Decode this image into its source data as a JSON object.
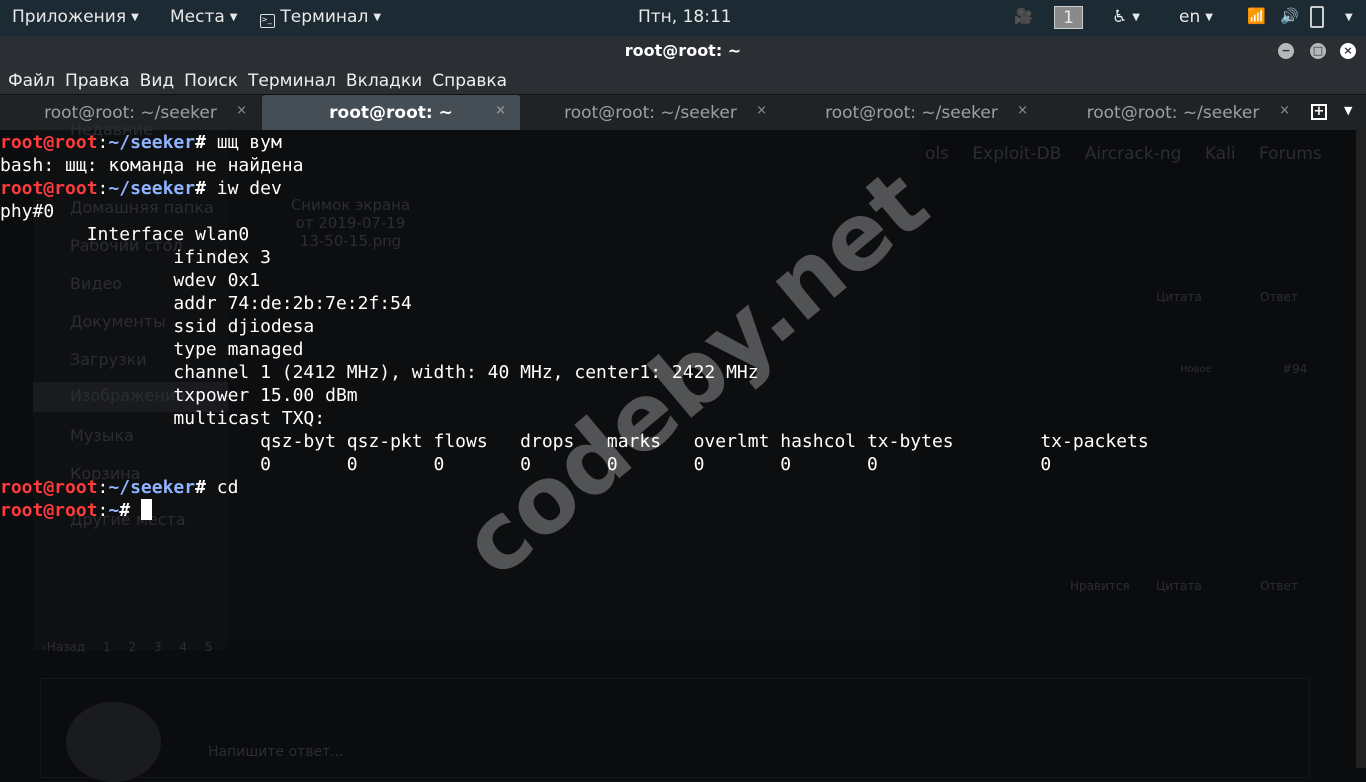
{
  "topbar": {
    "apps": "Приложения",
    "places": "Места",
    "terminal": "Терминал",
    "clock": "Птн, 18:11",
    "workspace": "1",
    "lang": "en"
  },
  "window": {
    "title": "root@root: ~"
  },
  "menu": [
    "Файл",
    "Правка",
    "Вид",
    "Поиск",
    "Терминал",
    "Вкладки",
    "Справка"
  ],
  "tabs": [
    {
      "label": "root@root: ~/seeker"
    },
    {
      "label": "root@root: ~",
      "active": true
    },
    {
      "label": "root@root: ~/seeker"
    },
    {
      "label": "root@root: ~/seeker"
    },
    {
      "label": "root@root: ~/seeker"
    }
  ],
  "background": {
    "sidebar": [
      "Недавние",
      "Домашняя папка",
      "Рабочий стол",
      "Видео",
      "Документы",
      "Загрузки",
      "Изображения",
      "Музыка",
      "Корзина",
      "Другие места"
    ],
    "file_label": "Снимок экрана от 2019-07-19 13-50-15.png",
    "bookmarks": [
      "ols",
      "Exploit-DB",
      "Aircrack-ng",
      "Kali Forums"
    ],
    "post_buttons": [
      "Цитата",
      "Ответ",
      "Нравится",
      "Цитата",
      "Ответ"
    ],
    "badge": "Новое",
    "post_num": "#94",
    "pager": [
      "‹Назад",
      "1",
      "2",
      "3",
      "4",
      "5"
    ],
    "reply_placeholder": "Напишите ответ..."
  },
  "watermark": "codeby.net",
  "terminal": {
    "user": "root@root",
    "lines": [
      {
        "path": ":~/seeker",
        "cmd": "# шщ вум"
      },
      {
        "out": "bash: шщ: команда не найдена"
      },
      {
        "path": ":~/seeker",
        "cmd": "# iw dev"
      },
      {
        "out": "phy#0"
      },
      {
        "out": "        Interface wlan0"
      },
      {
        "out": "                ifindex 3"
      },
      {
        "out": "                wdev 0x1"
      },
      {
        "out": "                addr 74:de:2b:7e:2f:54"
      },
      {
        "out": "                ssid djiodesa"
      },
      {
        "out": "                type managed"
      },
      {
        "out": "                channel 1 (2412 MHz), width: 40 MHz, center1: 2422 MHz"
      },
      {
        "out": "                txpower 15.00 dBm"
      },
      {
        "out": "                multicast TXQ:"
      },
      {
        "out": "                        qsz-byt qsz-pkt flows   drops   marks   overlmt hashcol tx-bytes        tx-packets"
      },
      {
        "out": "                        0       0       0       0       0       0       0       0               0"
      },
      {
        "path": ":~/seeker",
        "cmd": "# cd"
      },
      {
        "path": ":~",
        "cmd": "# "
      }
    ]
  }
}
